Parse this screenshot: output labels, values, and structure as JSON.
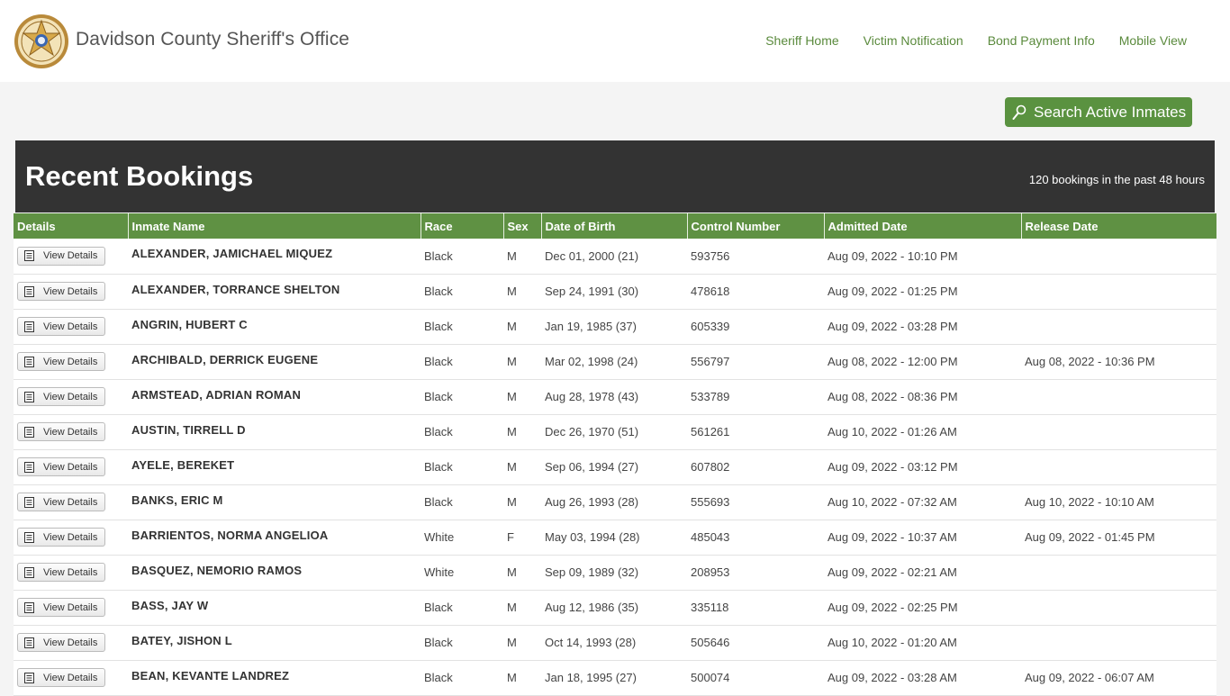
{
  "header": {
    "site_title": "Davidson County Sheriff's Office",
    "nav": [
      "Sheriff Home",
      "Victim Notification",
      "Bond Payment Info",
      "Mobile View"
    ]
  },
  "search_button": {
    "label": "Search Active Inmates",
    "icon": "magnifier-icon"
  },
  "panel": {
    "title": "Recent Bookings",
    "count_text": "120 bookings in the past 48 hours"
  },
  "table": {
    "columns": [
      "Details",
      "Inmate Name",
      "Race",
      "Sex",
      "Date of Birth",
      "Control Number",
      "Admitted Date",
      "Release Date"
    ],
    "details_label": "View Details",
    "rows": [
      {
        "name": "ALEXANDER, JAMICHAEL  MIQUEZ",
        "race": "Black",
        "sex": "M",
        "dob": "Dec 01, 2000 (21)",
        "control": "593756",
        "admitted": "Aug 09, 2022 - 10:10 PM",
        "release": ""
      },
      {
        "name": "ALEXANDER, TORRANCE  SHELTON",
        "race": "Black",
        "sex": "M",
        "dob": "Sep 24, 1991 (30)",
        "control": "478618",
        "admitted": "Aug 09, 2022 - 01:25 PM",
        "release": ""
      },
      {
        "name": "ANGRIN, HUBERT  C",
        "race": "Black",
        "sex": "M",
        "dob": "Jan 19, 1985 (37)",
        "control": "605339",
        "admitted": "Aug 09, 2022 - 03:28 PM",
        "release": ""
      },
      {
        "name": "ARCHIBALD, DERRICK  EUGENE",
        "race": "Black",
        "sex": "M",
        "dob": "Mar 02, 1998 (24)",
        "control": "556797",
        "admitted": "Aug 08, 2022 - 12:00 PM",
        "release": "Aug 08, 2022 - 10:36 PM"
      },
      {
        "name": "ARMSTEAD, ADRIAN  ROMAN",
        "race": "Black",
        "sex": "M",
        "dob": "Aug 28, 1978 (43)",
        "control": "533789",
        "admitted": "Aug 08, 2022 - 08:36 PM",
        "release": ""
      },
      {
        "name": "AUSTIN, TIRRELL  D",
        "race": "Black",
        "sex": "M",
        "dob": "Dec 26, 1970 (51)",
        "control": "561261",
        "admitted": "Aug 10, 2022 - 01:26 AM",
        "release": ""
      },
      {
        "name": "AYELE, BEREKET",
        "race": "Black",
        "sex": "M",
        "dob": "Sep 06, 1994 (27)",
        "control": "607802",
        "admitted": "Aug 09, 2022 - 03:12 PM",
        "release": ""
      },
      {
        "name": "BANKS, ERIC  M",
        "race": "Black",
        "sex": "M",
        "dob": "Aug 26, 1993 (28)",
        "control": "555693",
        "admitted": "Aug 10, 2022 - 07:32 AM",
        "release": "Aug 10, 2022 - 10:10 AM"
      },
      {
        "name": "BARRIENTOS, NORMA  ANGELIOA",
        "race": "White",
        "sex": "F",
        "dob": "May 03, 1994 (28)",
        "control": "485043",
        "admitted": "Aug 09, 2022 - 10:37 AM",
        "release": "Aug 09, 2022 - 01:45 PM"
      },
      {
        "name": "BASQUEZ, NEMORIO  RAMOS",
        "race": "White",
        "sex": "M",
        "dob": "Sep 09, 1989 (32)",
        "control": "208953",
        "admitted": "Aug 09, 2022 - 02:21 AM",
        "release": ""
      },
      {
        "name": "BASS, JAY  W",
        "race": "Black",
        "sex": "M",
        "dob": "Aug 12, 1986 (35)",
        "control": "335118",
        "admitted": "Aug 09, 2022 - 02:25 PM",
        "release": ""
      },
      {
        "name": "BATEY, JISHON  L",
        "race": "Black",
        "sex": "M",
        "dob": "Oct 14, 1993 (28)",
        "control": "505646",
        "admitted": "Aug 10, 2022 - 01:20 AM",
        "release": ""
      },
      {
        "name": "BEAN, KEVANTE  LANDREZ",
        "race": "Black",
        "sex": "M",
        "dob": "Jan 18, 1995 (27)",
        "control": "500074",
        "admitted": "Aug 09, 2022 - 03:28 AM",
        "release": "Aug 09, 2022 - 06:07 AM"
      }
    ]
  }
}
